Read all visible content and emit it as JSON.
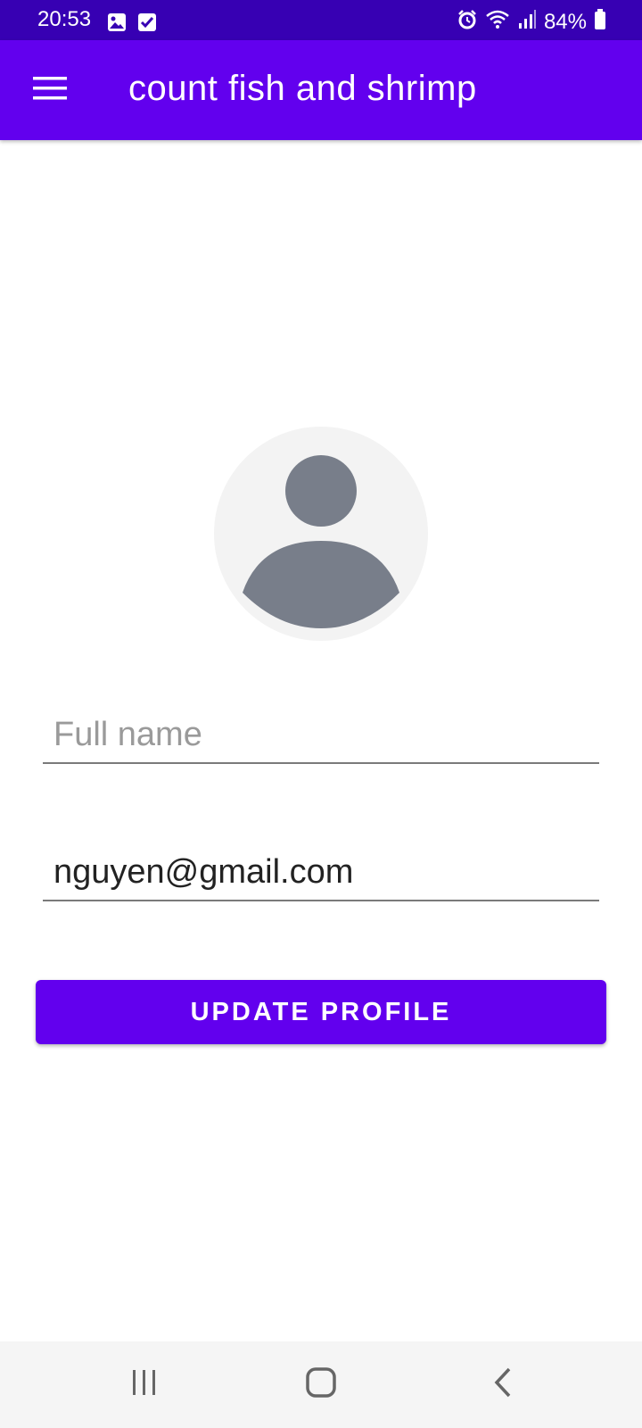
{
  "status_bar": {
    "time": "20:53",
    "battery": "84%",
    "icons": [
      "gallery-icon",
      "checkbox-icon",
      "alarm-icon",
      "wifi-icon",
      "signal-icon",
      "battery-icon"
    ]
  },
  "app_bar": {
    "title": "count fish and shrimp",
    "menu_icon": "hamburger-menu-icon",
    "background": "#6200ee"
  },
  "profile": {
    "avatar_icon": "person-icon",
    "full_name": {
      "value": "",
      "placeholder": "Full name"
    },
    "email": {
      "value": "nguyen@gmail.com"
    },
    "update_label": "UPDATE PROFILE"
  },
  "nav_bar": {
    "icons": [
      "recent-apps-icon",
      "home-icon",
      "back-icon"
    ]
  },
  "colors": {
    "primary": "#6200ee",
    "status_bar": "#3700b3",
    "avatar_fill": "#787e8a"
  }
}
